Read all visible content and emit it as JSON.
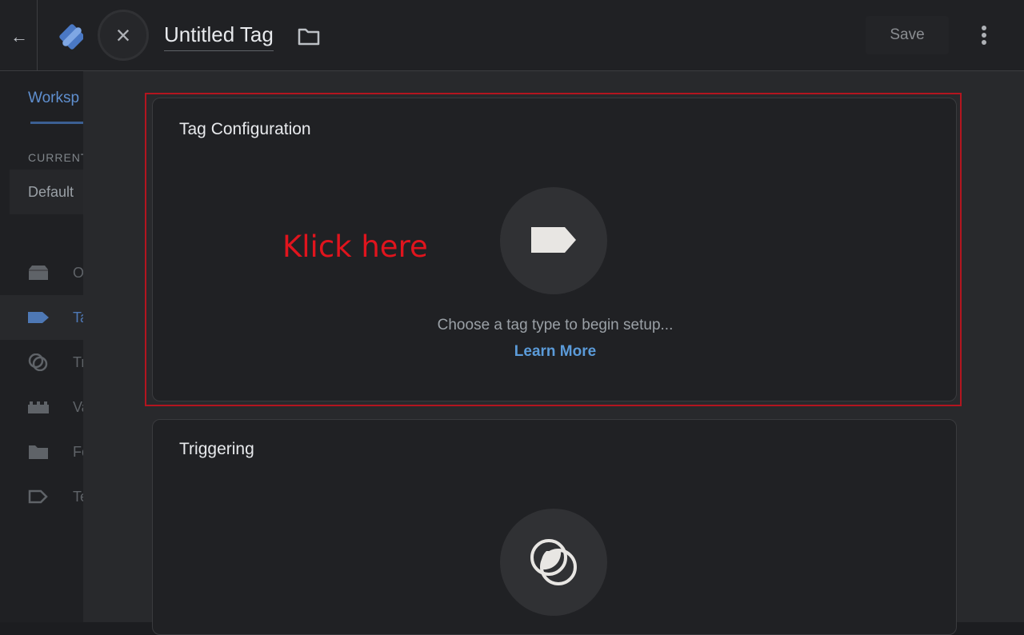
{
  "background_page": {
    "workspace_tab": "Worksp",
    "current_label": "CURRENT",
    "workspace_name": "Default",
    "nav": [
      {
        "icon": "overview-icon",
        "label": "O",
        "active": false
      },
      {
        "icon": "tag-icon",
        "label": "Ta",
        "active": true
      },
      {
        "icon": "trigger-icon",
        "label": "Tr",
        "active": false
      },
      {
        "icon": "variables-icon",
        "label": "Va",
        "active": false
      },
      {
        "icon": "folder-icon",
        "label": "Fo",
        "active": false
      },
      {
        "icon": "template-icon",
        "label": "Te",
        "active": false
      }
    ]
  },
  "panel": {
    "close_icon": "×",
    "title": "Untitled Tag",
    "save_label": "Save",
    "tag_configuration": {
      "title": "Tag Configuration",
      "hint": "Choose a tag type to begin setup...",
      "learn_more": "Learn More"
    },
    "triggering": {
      "title": "Triggering"
    }
  },
  "annotation": {
    "text": "Klick here",
    "color": "#e0141d"
  },
  "colors": {
    "accent_blue": "#5b9bd9",
    "highlight_red": "#b3151f"
  }
}
